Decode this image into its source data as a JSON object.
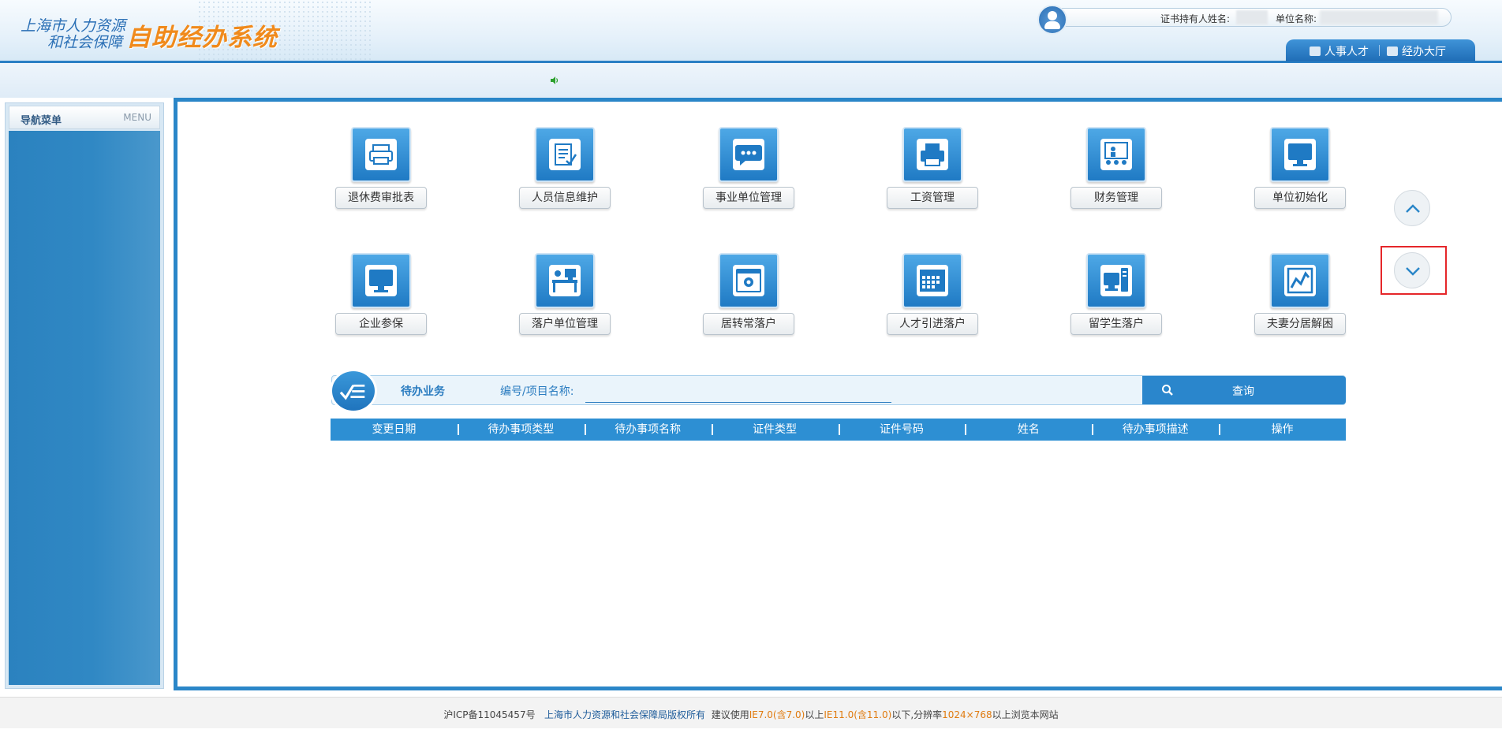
{
  "header": {
    "logo_line1": "上海市人力资源",
    "logo_line2": "和社会保障",
    "logo_main": "自助经办系统",
    "holder_label": "证书持有人姓名:",
    "unit_label": "单位名称:",
    "tabs": [
      {
        "label": "人事人才",
        "icon": "hr-icon"
      },
      {
        "label": "经办大厅",
        "icon": "hall-icon"
      }
    ]
  },
  "sidebar": {
    "title": "导航菜单",
    "menu_label": "MENU"
  },
  "tiles": [
    {
      "label": "退休费审批表",
      "icon": "printer-icon"
    },
    {
      "label": "人员信息维护",
      "icon": "document-edit-icon"
    },
    {
      "label": "事业单位管理",
      "icon": "chat-bubble-icon"
    },
    {
      "label": "工资管理",
      "icon": "fax-printer-icon"
    },
    {
      "label": "财务管理",
      "icon": "presentation-icon"
    },
    {
      "label": "单位初始化",
      "icon": "monitor-icon"
    },
    {
      "label": "企业参保",
      "icon": "monitor-icon"
    },
    {
      "label": "落户单位管理",
      "icon": "desk-icon"
    },
    {
      "label": "居转常落户",
      "icon": "settings-window-icon"
    },
    {
      "label": "人才引进落户",
      "icon": "calendar-icon"
    },
    {
      "label": "留学生落户",
      "icon": "computer-tower-icon"
    },
    {
      "label": "夫妻分居解困",
      "icon": "line-chart-icon"
    }
  ],
  "nav_buttons": {
    "up_icon": "chevron-up-icon",
    "down_icon": "chevron-down-icon",
    "highlight_color": "#e5262a"
  },
  "pending": {
    "title": "待办业务",
    "search_label": "编号/项目名称:",
    "search_value": "",
    "query_label": "查询",
    "columns": [
      "变更日期",
      "待办事项类型",
      "待办事项名称",
      "证件类型",
      "证件号码",
      "姓名",
      "待办事项描述",
      "操作"
    ]
  },
  "footer": {
    "icp": "沪ICP备11045457号",
    "copyright": "上海市人力资源和社会保障局版权所有",
    "advice_prefix": "建议使用",
    "ie7": "IE7.0(含7.0)",
    "above": "以上",
    "ie11": "IE11.0(含11.0)",
    "below_res": "以下,分辨率",
    "resolution": "1024×768",
    "suffix": "以上浏览本网站"
  },
  "colors": {
    "accent": "#2a86c8",
    "logo_orange": "#f08a1c",
    "logo_blue": "#2a6fb5"
  }
}
